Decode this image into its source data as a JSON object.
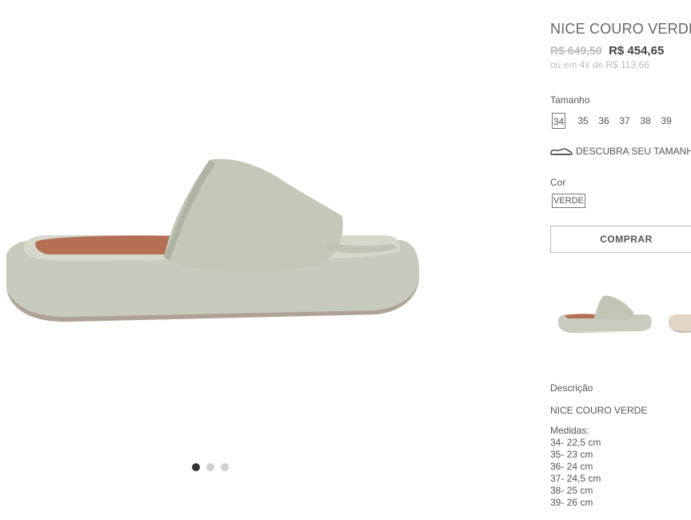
{
  "product": {
    "title": "NICE COURO VERDE",
    "old_price": "R$ 649,50",
    "price": "R$ 454,65",
    "installments": "ou em 4x de R$ 113,66"
  },
  "size_selector": {
    "label": "Tamanho",
    "options": [
      "34",
      "35",
      "36",
      "37",
      "38",
      "39"
    ],
    "selected": "34"
  },
  "size_guide": {
    "label": "DESCUBRA SEU TAMANHO",
    "icon": "shoe-icon"
  },
  "color_selector": {
    "label": "Cor",
    "selected": "VERDE"
  },
  "buy_button": {
    "label": "COMPRAR"
  },
  "gallery": {
    "slides": 3,
    "active_slide": 1
  },
  "description": {
    "label": "Descrição",
    "name": "NICE COURO VERDE",
    "measures_title": "Medidas:",
    "measures": [
      "34- 22,5 cm",
      "35- 23 cm",
      "36- 24 cm",
      "37- 24,5 cm",
      "38- 25 cm",
      "39- 26 cm"
    ]
  },
  "colors": {
    "sandal": "#c9cec0",
    "sole_inner": "#b5755a",
    "text": "#555555",
    "muted": "#bbbbbb"
  }
}
